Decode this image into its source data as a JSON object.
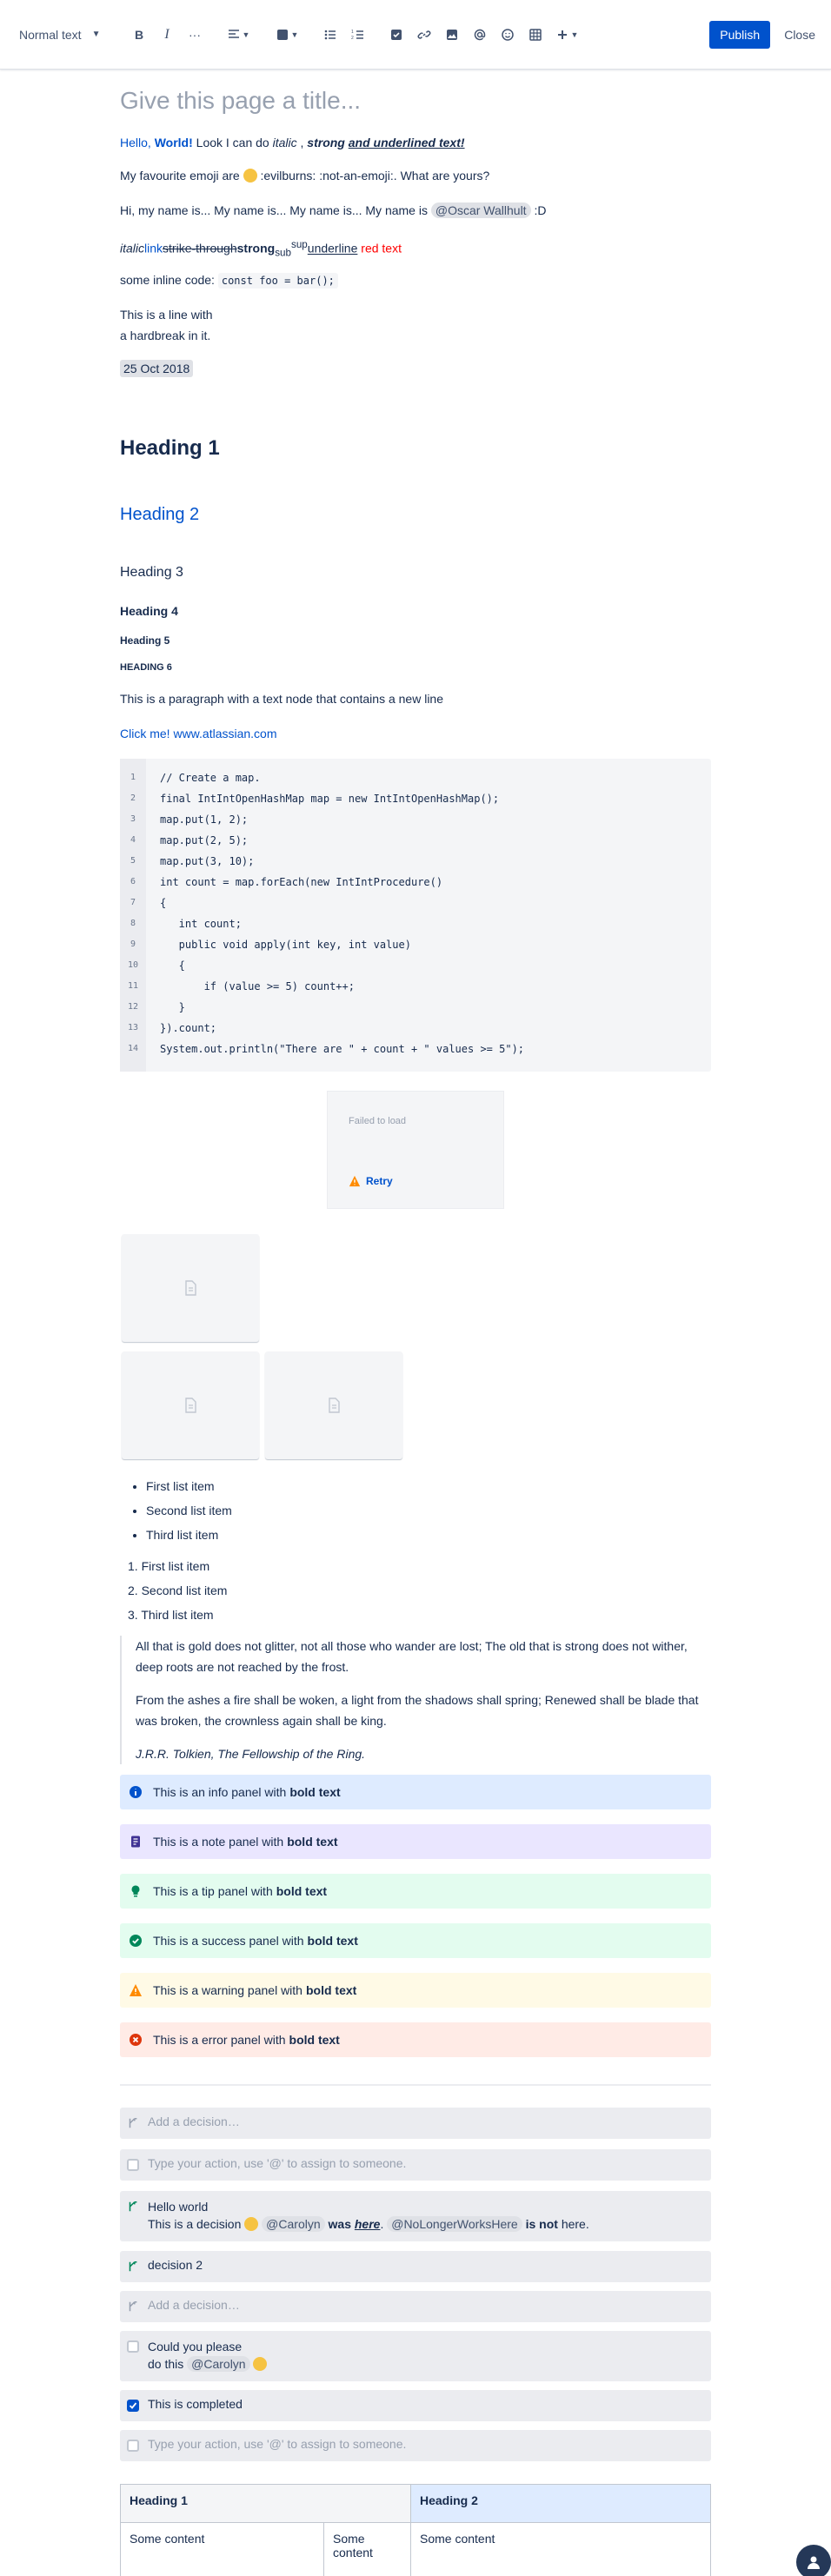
{
  "toolbar": {
    "text_style": "Normal text",
    "bold": "B",
    "italic": "I",
    "more": "···",
    "publish": "Publish",
    "close": "Close"
  },
  "editor": {
    "title_placeholder": "Give this page a title...",
    "p1": {
      "hello": "Hello, ",
      "world": "World!",
      "look": " Look I can do ",
      "italic": "italic",
      "comma": " , ",
      "strong": "strong",
      "space": " ",
      "underlined": "and underlined text!"
    },
    "p2": {
      "text": "My favourite emoji are ",
      "rest": " :evilburns: :not-an-emoji:. What are yours?"
    },
    "p3": {
      "text": "Hi, my name is... My name is... My name is... My name is ",
      "mention": "@Oscar Wallhult",
      "end": " :D"
    },
    "p4": {
      "italic": "italic",
      "link": "link",
      "strike": "strike-through",
      "strong": "strong",
      "sub": "sub",
      "sup": "sup",
      "underline": "underline",
      "red": "red text"
    },
    "p5": {
      "label": "some inline code: ",
      "code": "const foo = bar();"
    },
    "p6": {
      "line1": "This is a line with",
      "line2": "a hardbreak in it."
    },
    "date": "25 Oct 2018",
    "h1": "Heading 1",
    "h2": "Heading 2",
    "h3": "Heading 3",
    "h4": "Heading 4",
    "h5": "Heading 5",
    "h6": "HEADING 6",
    "para_newline": "This is a paragraph with a text node that contains a new line",
    "click_me": "Click me! ",
    "link_url": "www.atlassian.com",
    "code_lines": [
      {
        "n": "1",
        "t": "// Create a map."
      },
      {
        "n": "2",
        "t": "final IntIntOpenHashMap map = new IntIntOpenHashMap();"
      },
      {
        "n": "3",
        "t": "map.put(1, 2);"
      },
      {
        "n": "4",
        "t": "map.put(2, 5);"
      },
      {
        "n": "5",
        "t": "map.put(3, 10);"
      },
      {
        "n": "6",
        "t": "int count = map.forEach(new IntIntProcedure()"
      },
      {
        "n": "7",
        "t": "{"
      },
      {
        "n": "8",
        "t": "   int count;"
      },
      {
        "n": "9",
        "t": "   public void apply(int key, int value)"
      },
      {
        "n": "10",
        "t": "   {"
      },
      {
        "n": "11",
        "t": "       if (value >= 5) count++;"
      },
      {
        "n": "12",
        "t": "   }"
      },
      {
        "n": "13",
        "t": "}).count;"
      },
      {
        "n": "14",
        "t": "System.out.println(\"There are \" + count + \" values >= 5\");"
      }
    ],
    "failed_to_load": "Failed to load",
    "retry": "Retry",
    "bullets": [
      "First list item",
      "Second list item",
      "Third list item"
    ],
    "numbered": [
      "First list item",
      "Second list item",
      "Third list item"
    ],
    "numbered_markers": [
      "1.",
      "2.",
      "3."
    ],
    "quote": [
      "All that is gold does not glitter, not all those who wander are lost; The old that is strong does not wither, deep roots are not reached by the frost.",
      "From the ashes a fire shall be woken, a light from the shadows shall spring; Renewed shall be blade that was broken, the crownless again shall be king.",
      "J.R.R. Tolkien, The Fellowship of the Ring."
    ],
    "panels": [
      {
        "pre": "This is an info panel with ",
        "bold": "bold text",
        "bg": "#DEEBFF",
        "icon": "info-icon",
        "color": "#0052CC"
      },
      {
        "pre": "This is a note panel with ",
        "bold": "bold text",
        "bg": "#EAE6FF",
        "icon": "note-icon",
        "color": "#403294"
      },
      {
        "pre": "This is a tip panel with ",
        "bold": "bold text",
        "bg": "#E3FCEF",
        "icon": "tip-icon",
        "color": "#00875A"
      },
      {
        "pre": "This is a success panel with ",
        "bold": "bold text",
        "bg": "#E3FCEF",
        "icon": "success-icon",
        "color": "#00875A"
      },
      {
        "pre": "This is a warning panel with ",
        "bold": "bold text",
        "bg": "#FFFAE6",
        "icon": "warning-icon",
        "color": "#FF8B00"
      },
      {
        "pre": "This is a error panel with ",
        "bold": "bold text",
        "bg": "#FFEBE6",
        "icon": "error-icon",
        "color": "#DE350B"
      }
    ],
    "add_decision": "Add a decision…",
    "action_placeholder": "Type your action, use '@' to assign to someone.",
    "decision1": {
      "line1": "Hello world",
      "pre": "This is a decision ",
      "mention1": "@Carolyn",
      "was": " was ",
      "here": "here",
      "dot": ". ",
      "mention2": "@NoLongerWorksHere",
      "isnot": " is not",
      "end": " here."
    },
    "decision2": "decision 2",
    "action1": {
      "line1": "Could you please",
      "pre": "do this ",
      "mention": "@Carolyn"
    },
    "action_done": "This is completed",
    "table": {
      "h1": "Heading 1",
      "h2": "Heading 2",
      "c1": "Some content",
      "c2": "Some content",
      "c3": "Some content"
    }
  },
  "colors": {
    "accent": "#0052CC",
    "text": "#172B4D"
  }
}
